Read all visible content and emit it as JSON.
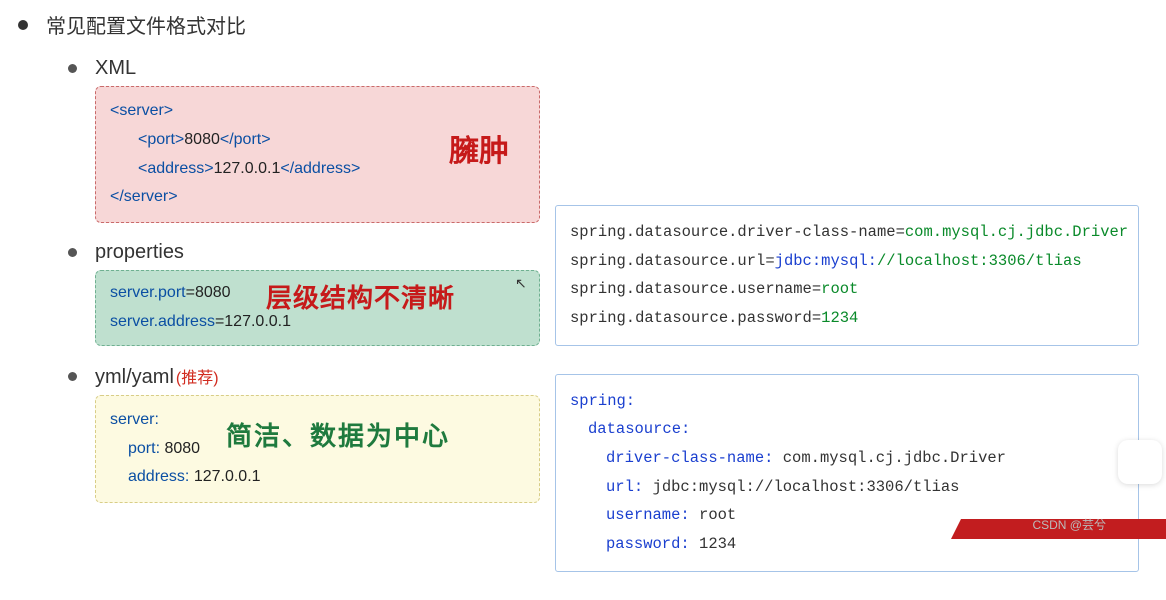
{
  "main": {
    "title": "常见配置文件格式对比"
  },
  "sections": {
    "xml": {
      "label": "XML",
      "code": {
        "l1": "<server>",
        "l2a": "<port>",
        "l2b": "8080",
        "l2c": "</port>",
        "l3a": "<address>",
        "l3b": "127.0.0.1",
        "l3c": "</address>",
        "l4": "</server>"
      },
      "annotation": "臃肿"
    },
    "properties": {
      "label": "properties",
      "code": {
        "l1k": "server.port",
        "l1eq": "=",
        "l1v": "8080",
        "l2k": "server.address",
        "l2eq": "=",
        "l2v": "127.0.0.1"
      },
      "annotation": "层级结构不清晰"
    },
    "yaml": {
      "label_a": "yml",
      "label_sep": "/",
      "label_b": "yaml",
      "rec": "(推荐)",
      "code": {
        "l1": "server:",
        "l2k": "port:",
        "l2v": " 8080",
        "l3k": "address:",
        "l3v": " 127.0.0.1"
      },
      "annotation": "简洁、数据为中心"
    }
  },
  "right": {
    "props": {
      "l1a": "spring.datasource.driver-class-name",
      "l1eq": "=",
      "l1b": "com.mysql.cj.jdbc.Driver",
      "l2a": "spring.datasource.url",
      "l2eq": "=",
      "l2b": "jdbc:mysql:",
      "l2c": "//localhost:3306/tlias",
      "l3a": "spring.datasource.username",
      "l3eq": "=",
      "l3b": "root",
      "l4a": "spring.datasource.password",
      "l4eq": "=",
      "l4b": "1234"
    },
    "yaml": {
      "l1": "spring:",
      "l2": "datasource:",
      "l3a": "driver-class-name:",
      "l3b": " com.mysql.cj.jdbc.Driver",
      "l4a": "url:",
      "l4b": " jdbc:mysql://localhost:3306/tlias",
      "l5a": "username:",
      "l5b": " root",
      "l6a": "password:",
      "l6b": " 1234"
    }
  },
  "watermark": "CSDN @芸兮"
}
